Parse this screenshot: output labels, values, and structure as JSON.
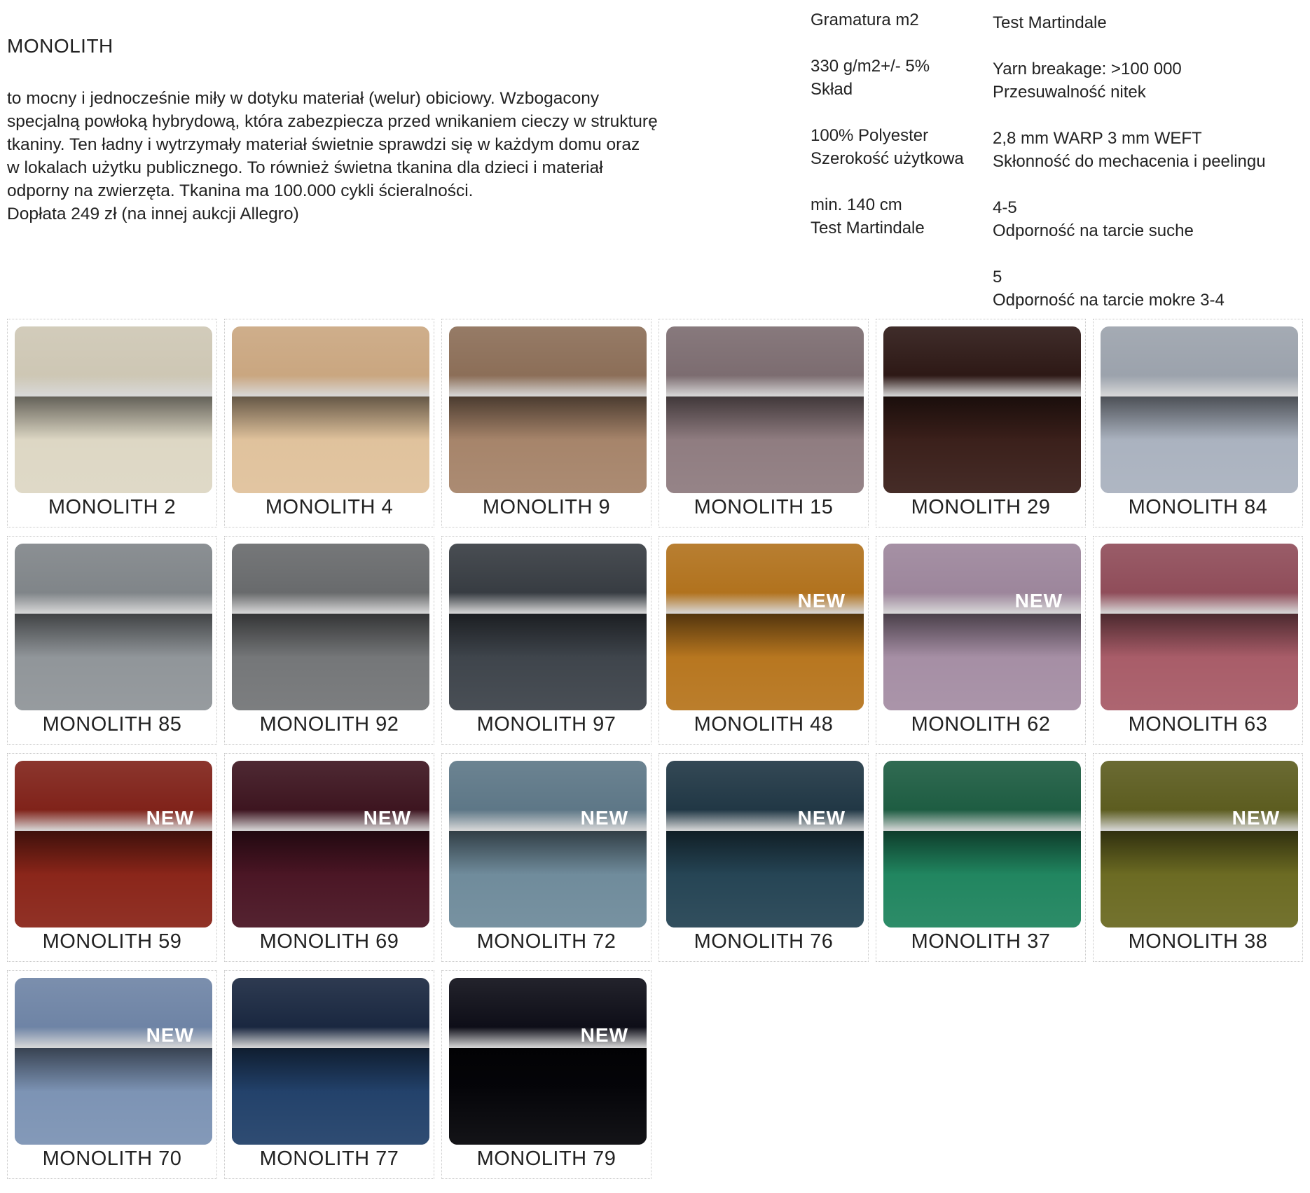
{
  "product": {
    "title": "MONOLITH",
    "description_lines": [
      "to mocny i jednocześnie miły w dotyku materiał (welur) obiciowy. Wzbogacony",
      "specjalną powłoką hybrydową, która zabezpiecza przed wnikaniem cieczy w strukturę",
      "tkaniny. Ten ładny i wytrzymały materiał świetnie sprawdzi się w każdym domu oraz",
      "w lokalach użytku publicznego. To również świetna tkanina dla dzieci i materiał",
      "odporny na zwierzęta. Tkanina ma 100.000 cykli ścieralności.",
      "Dopłata 249 zł (na innej aukcji Allegro)"
    ]
  },
  "specs_left": [
    "Gramatura m2",
    "330 g/m2+/- 5%",
    "Skład",
    "100% Polyester",
    "Szerokość użytkowa",
    "min. 140 cm",
    "Test Martindale"
  ],
  "specs_right": [
    "Test Martindale",
    "Yarn breakage: >100 000",
    "Przesuwalność nitek",
    "2,8 mm WARP 3 mm WEFT",
    "Skłonność do mechacenia i peelingu",
    "4-5",
    "Odporność na tarcie suche",
    "5",
    "Odporność na tarcie mokre 3-4"
  ],
  "new_badge_text": "NEW",
  "swatches": [
    {
      "name": "MONOLITH 2",
      "top": "#cdc6b3",
      "bottom": "#ddd7c4",
      "new": false
    },
    {
      "name": "MONOLITH 4",
      "top": "#c9a57e",
      "bottom": "#e0c29c",
      "new": false
    },
    {
      "name": "MONOLITH 9",
      "top": "#8a6c55",
      "bottom": "#a6846a",
      "new": false
    },
    {
      "name": "MONOLITH 15",
      "top": "#7a6a6e",
      "bottom": "#8f7c80",
      "new": false
    },
    {
      "name": "MONOLITH 29",
      "top": "#2a1512",
      "bottom": "#3a1f1a",
      "new": false
    },
    {
      "name": "MONOLITH 84",
      "top": "#9aa1ab",
      "bottom": "#aab2bf",
      "new": false
    },
    {
      "name": "MONOLITH 85",
      "top": "#7e8387",
      "bottom": "#909599",
      "new": false
    },
    {
      "name": "MONOLITH 92",
      "top": "#66686a",
      "bottom": "#747678",
      "new": false
    },
    {
      "name": "MONOLITH 97",
      "top": "#34393f",
      "bottom": "#3e444b",
      "new": false
    },
    {
      "name": "MONOLITH 48",
      "top": "#b0701a",
      "bottom": "#b7761f",
      "new": true
    },
    {
      "name": "MONOLITH 62",
      "top": "#9b849a",
      "bottom": "#a58ea4",
      "new": true
    },
    {
      "name": "MONOLITH 63",
      "top": "#8e4a57",
      "bottom": "#a85c68",
      "new": false
    },
    {
      "name": "MONOLITH 59",
      "top": "#7e1f16",
      "bottom": "#8a2519",
      "new": true
    },
    {
      "name": "MONOLITH 69",
      "top": "#3a111c",
      "bottom": "#4a1524",
      "new": true
    },
    {
      "name": "MONOLITH 72",
      "top": "#5b7585",
      "bottom": "#6f8b9b",
      "new": true
    },
    {
      "name": "MONOLITH 76",
      "top": "#1d3442",
      "bottom": "#254454",
      "new": true
    },
    {
      "name": "MONOLITH 37",
      "top": "#1a5a3f",
      "bottom": "#20855f",
      "new": false
    },
    {
      "name": "MONOLITH 38",
      "top": "#5a5a1c",
      "bottom": "#6b6a22",
      "new": true
    },
    {
      "name": "MONOLITH 70",
      "top": "#6c82a4",
      "bottom": "#7c93b4",
      "new": true
    },
    {
      "name": "MONOLITH 77",
      "top": "#16243d",
      "bottom": "#22416a",
      "new": false
    },
    {
      "name": "MONOLITH 79",
      "top": "#0a0a14",
      "bottom": "#050509",
      "new": true
    }
  ]
}
